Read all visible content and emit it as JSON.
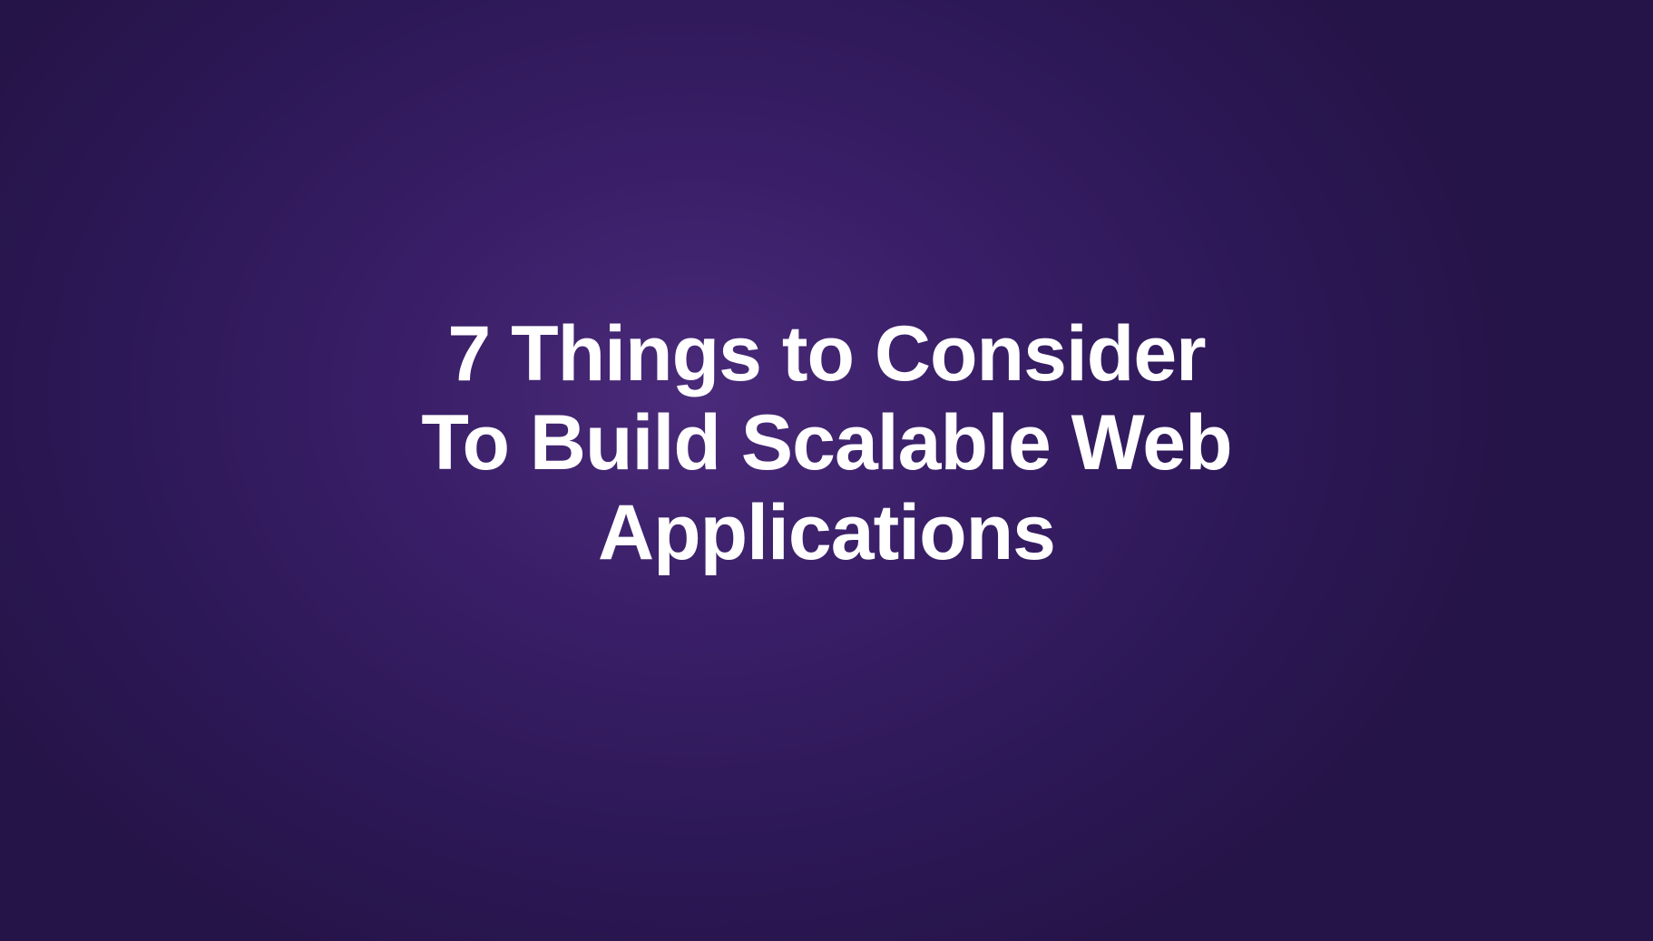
{
  "title": {
    "line1": "7 Things to Consider",
    "line2": "To Build Scalable Web",
    "line3": "Applications"
  }
}
